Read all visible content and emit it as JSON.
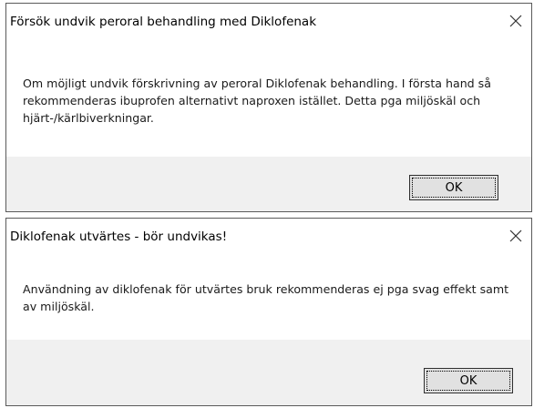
{
  "dialogs": [
    {
      "title": "Försök undvik peroral behandling med Diklofenak",
      "message": "Om möjligt undvik förskrivning av peroral Diklofenak behandling. I första hand så rekommenderas ibuprofen alternativt naproxen istället. Detta pga miljöskäl och hjärt-/kärlbiverkningar.",
      "ok_label": "OK",
      "close_icon": "close-icon"
    },
    {
      "title": "Diklofenak utvärtes - bör undvikas!",
      "message": "Användning av diklofenak för utvärtes bruk rekommenderas ej pga svag effekt samt av miljöskäl.",
      "ok_label": "OK",
      "close_icon": "close-icon"
    }
  ],
  "colors": {
    "footer_bg": "#f0f0f0",
    "button_bg": "#e1e1e1",
    "border": "#5a5a5a"
  }
}
